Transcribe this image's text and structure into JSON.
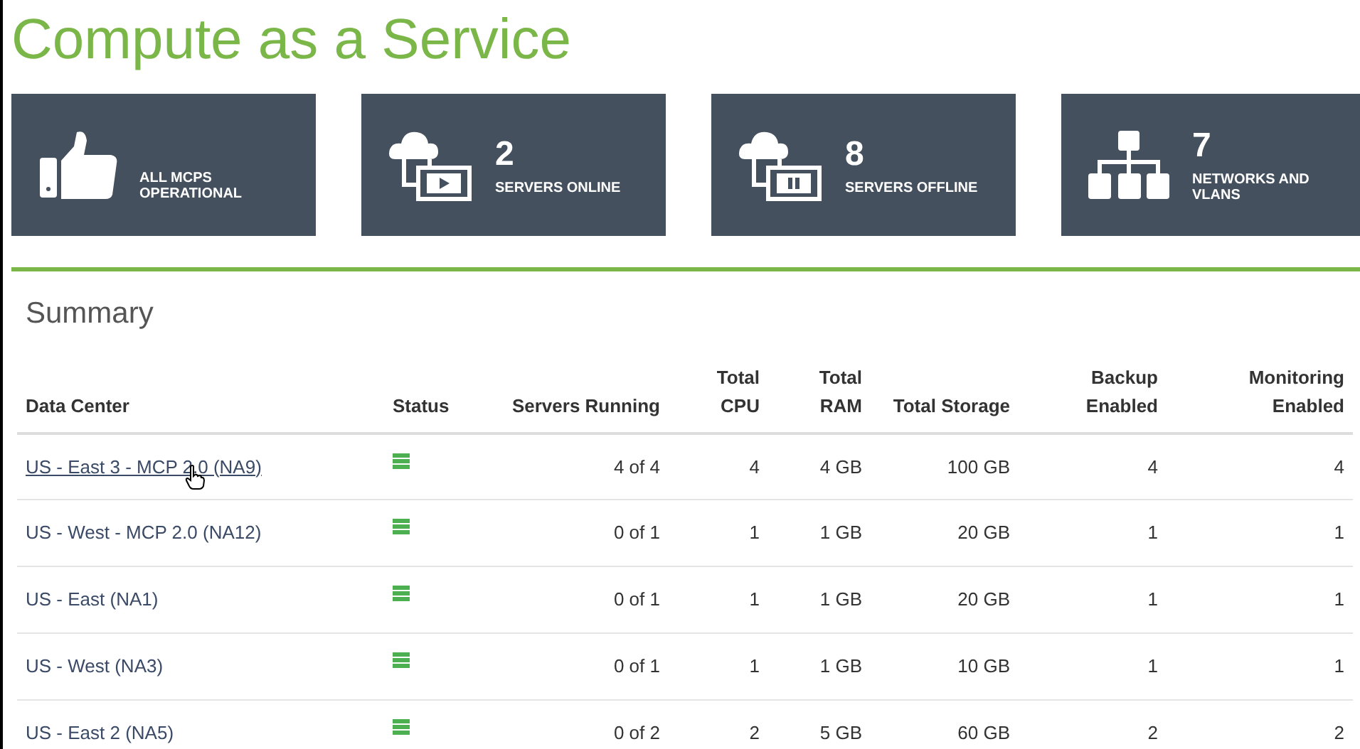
{
  "page": {
    "title": "Compute as a Service"
  },
  "tiles": [
    {
      "kind": "thumbs",
      "label": "ALL MCPS OPERATIONAL"
    },
    {
      "kind": "online",
      "count": "2",
      "label": "SERVERS ONLINE"
    },
    {
      "kind": "offline",
      "count": "8",
      "label": "SERVERS OFFLINE"
    },
    {
      "kind": "network",
      "count": "7",
      "label": "NETWORKS AND VLANS"
    }
  ],
  "summary": {
    "title": "Summary",
    "columns": [
      "Data Center",
      "Status",
      "Servers Running",
      "Total CPU",
      "Total RAM",
      "Total Storage",
      "Backup Enabled",
      "Monitoring Enabled"
    ],
    "rows": [
      {
        "hovered": true,
        "cells": [
          "US - East 3 - MCP 2.0 (NA9)",
          "",
          "4 of 4",
          "4",
          "4 GB",
          "100 GB",
          "4",
          "4"
        ]
      },
      {
        "hovered": false,
        "cells": [
          "US - West - MCP 2.0 (NA12)",
          "",
          "0 of 1",
          "1",
          "1 GB",
          "20 GB",
          "1",
          "1"
        ]
      },
      {
        "hovered": false,
        "cells": [
          "US - East (NA1)",
          "",
          "0 of 1",
          "1",
          "1 GB",
          "20 GB",
          "1",
          "1"
        ]
      },
      {
        "hovered": false,
        "cells": [
          "US - West (NA3)",
          "",
          "0 of 1",
          "1",
          "1 GB",
          "10 GB",
          "1",
          "1"
        ]
      },
      {
        "hovered": false,
        "cells": [
          "US - East 2 (NA5)",
          "",
          "0 of 2",
          "2",
          "5 GB",
          "60 GB",
          "2",
          "2"
        ]
      }
    ]
  }
}
